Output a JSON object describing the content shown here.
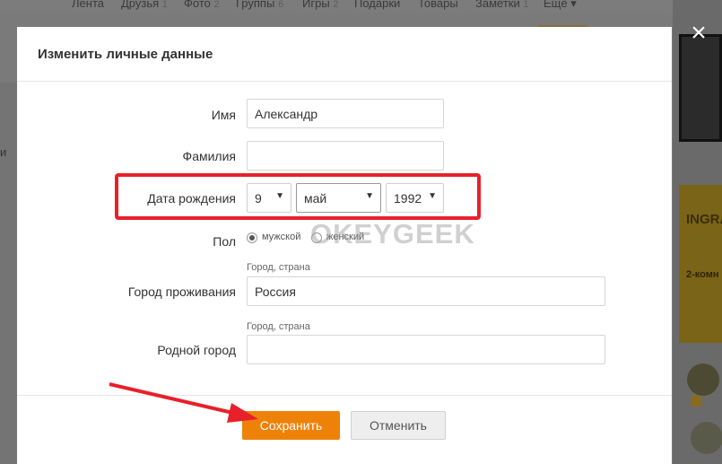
{
  "background": {
    "nav": [
      {
        "label": "Лента",
        "count": ""
      },
      {
        "label": "Друзья",
        "count": "1"
      },
      {
        "label": "Фото",
        "count": "2"
      },
      {
        "label": "Группы",
        "count": "6"
      },
      {
        "label": "Игры",
        "count": "2"
      },
      {
        "label": "Подарки",
        "count": ""
      },
      {
        "label": "Товары",
        "count": ""
      },
      {
        "label": "Заметки",
        "count": "1"
      },
      {
        "label": "Ещё ▾",
        "count": ""
      }
    ],
    "left_text": "и",
    "ad_text1": "INGRA",
    "ad_text2": "2-комн"
  },
  "dialog": {
    "title": "Изменить личные данные",
    "close_icon": "close-icon",
    "fields": {
      "first_name": {
        "label": "Имя",
        "value": "Александр"
      },
      "last_name": {
        "label": "Фамилия",
        "value": ""
      },
      "birth_date": {
        "label": "Дата рождения",
        "day": "9",
        "month": "май",
        "year": "1992"
      },
      "gender": {
        "label": "Пол",
        "options": [
          "мужской",
          "женский"
        ],
        "selected": "мужской"
      },
      "city": {
        "label": "Город проживания",
        "hint": "Город, страна",
        "value": "Россия"
      },
      "hometown": {
        "label": "Родной город",
        "hint": "Город, страна",
        "value": ""
      }
    },
    "buttons": {
      "save": "Сохранить",
      "cancel": "Отменить"
    }
  },
  "watermark": "OKEYGEEK",
  "colors": {
    "accent": "#ee8208",
    "annotation": "#e8202a"
  }
}
